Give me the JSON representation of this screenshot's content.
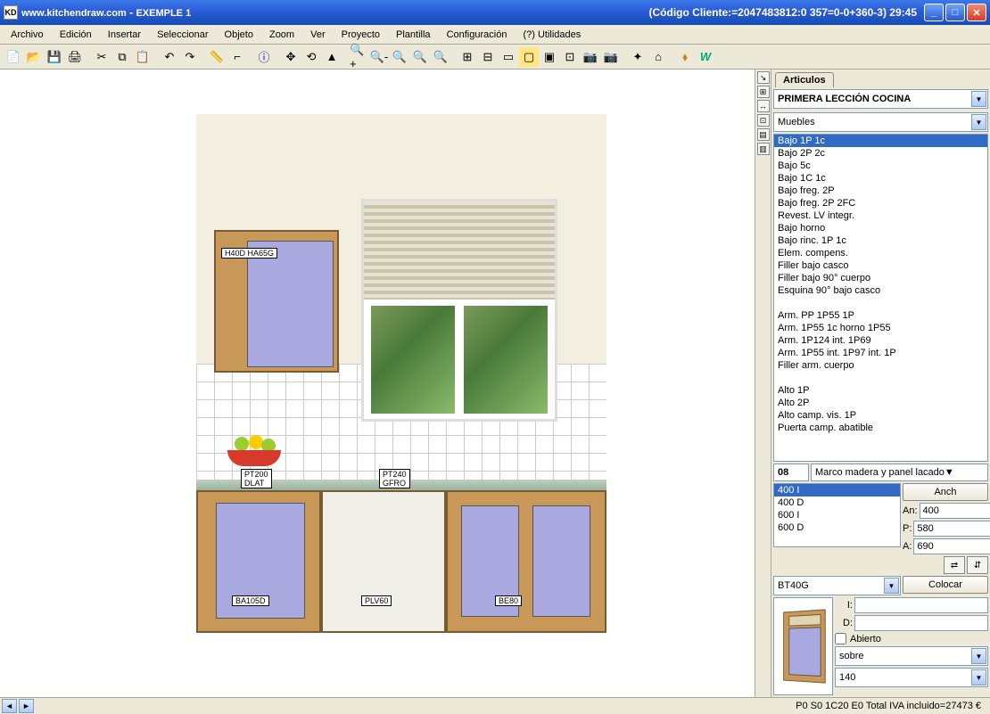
{
  "title": {
    "app": "www.kitchendraw.com",
    "doc": "EXEMPLE 1",
    "icon": "KD"
  },
  "client_code": "(Código Cliente:=2047483812:0 357=0-0+360-3) 29:45",
  "menu": [
    "Archivo",
    "Edición",
    "Insertar",
    "Seleccionar",
    "Objeto",
    "Zoom",
    "Ver",
    "Proyecto",
    "Plantilla",
    "Configuración",
    "(?) Utilidades"
  ],
  "drawing_labels": {
    "upper": "H40D HA65G",
    "pt200": "PT200\nDLAT",
    "pt240": "PT240\nGFRO",
    "ba": "BA105D",
    "plv": "PLV60",
    "be": "BE80"
  },
  "panel": {
    "tab": "Articulos",
    "lesson": "PRIMERA LECCIÓN COCINA",
    "category": "Muebles",
    "items": [
      "Bajo 1P 1c",
      "Bajo 2P 2c",
      "Bajo 5c",
      "Bajo 1C 1c",
      "Bajo freg. 2P",
      "Bajo freg. 2P 2FC",
      "Revest. LV integr.",
      "Bajo horno",
      "Bajo rinc. 1P 1c",
      "Elem. compens.",
      "Filler bajo casco",
      "Filler bajo 90° cuerpo",
      "Esquina 90° bajo casco",
      "",
      "Arm. PP 1P55 1P",
      "Arm. 1P55 1c horno 1P55",
      "Arm. 1P124 int. 1P69",
      "Arm. 1P55 int. 1P97 int. 1P",
      "Filler arm. cuerpo",
      "",
      "Alto 1P",
      "Alto 2P",
      "Alto camp. vis. 1P",
      "Puerta camp. abatible"
    ],
    "selected_item": 0,
    "code": "08",
    "desc": "Marco madera y panel lacado",
    "variants": [
      "400 I",
      "400 D",
      "600 I",
      "600 D"
    ],
    "selected_variant": 0,
    "anch_btn": "Anch",
    "dims": {
      "an_label": "An:",
      "an": "400",
      "p_label": "P:",
      "p": "580",
      "a_label": "A:",
      "a": "690"
    },
    "ref": "BT40G",
    "colocar": "Colocar",
    "i_label": "I:",
    "i": "",
    "d_label": "D:",
    "d": "",
    "abierto": "Abierto",
    "sobre": "sobre",
    "alt": "140"
  },
  "status": "P0 S0 1C20 E0 Total IVA incluido=27473 €"
}
